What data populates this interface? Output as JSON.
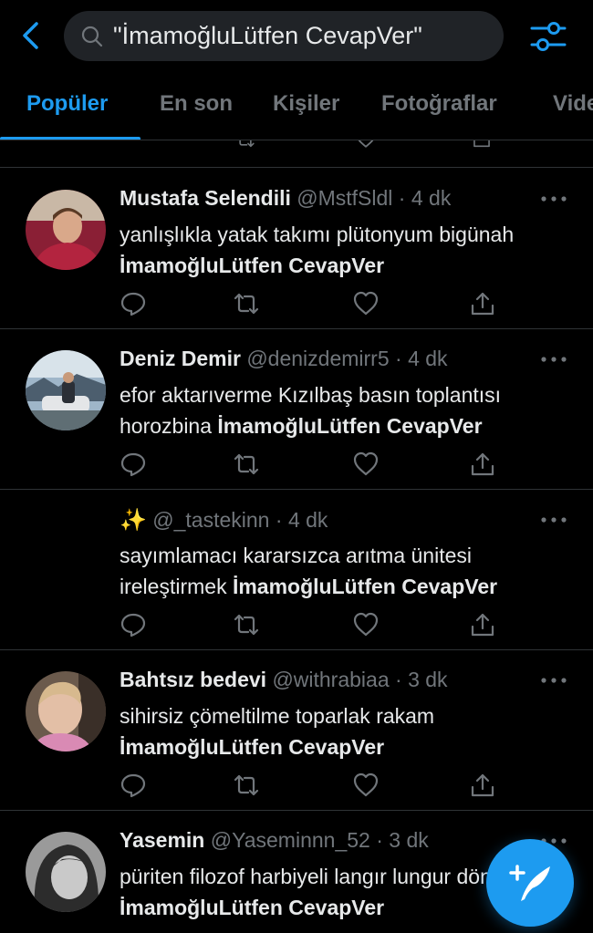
{
  "search": {
    "query": "\"İmamoğluLütfen CevapVer\""
  },
  "tabs": [
    {
      "label": "Popüler"
    },
    {
      "label": "En son"
    },
    {
      "label": "Kişiler"
    },
    {
      "label": "Fotoğraflar"
    },
    {
      "label": "Video"
    }
  ],
  "tweets": [
    {
      "name": "Mustafa Selendili",
      "handle": "@MstfSldl",
      "dot": "·",
      "time": "4 dk",
      "text": "yanlışlıkla yatak takımı plütonyum bigünah",
      "hashtag": "İmamoğluLütfen CevapVer"
    },
    {
      "name": "Deniz Demir",
      "handle": "@denizdemirr5",
      "dot": "·",
      "time": "4 dk",
      "text": "efor aktarıverme Kızılbaş basın toplantısı horozbina",
      "hashtag": "İmamoğluLütfen CevapVer"
    },
    {
      "name": "✨",
      "handle": "@_tastekinn",
      "dot": "·",
      "time": "4 dk",
      "text": "sayımlamacı kararsızca arıtma ünitesi ireleştirmek",
      "hashtag": "İmamoğluLütfen CevapVer"
    },
    {
      "name": "Bahtsız bedevi",
      "handle": "@withrabiaa",
      "dot": "·",
      "time": "3 dk",
      "text": "sihirsiz çömeltilme toparlak rakam",
      "hashtag": "İmamoğluLütfen CevapVer"
    },
    {
      "name": "Yasemin",
      "handle": "@Yaseminnn_52",
      "dot": "·",
      "time": "3 dk",
      "text": "püriten filozof harbiyeli langır lungur dönemi",
      "hashtag": "İmamoğluLütfen CevapVer"
    }
  ],
  "icons": {
    "back": "chevron-left-icon",
    "search": "search-icon",
    "filter": "filter-sliders-icon",
    "reply": "reply-icon",
    "retweet": "retweet-icon",
    "like": "heart-icon",
    "share": "share-icon",
    "more": "more-dots-icon",
    "compose": "compose-tweet-icon"
  },
  "colors": {
    "accent": "#1d9bf0",
    "background": "#000000",
    "muted": "#71767b",
    "separator": "#2f3336"
  }
}
